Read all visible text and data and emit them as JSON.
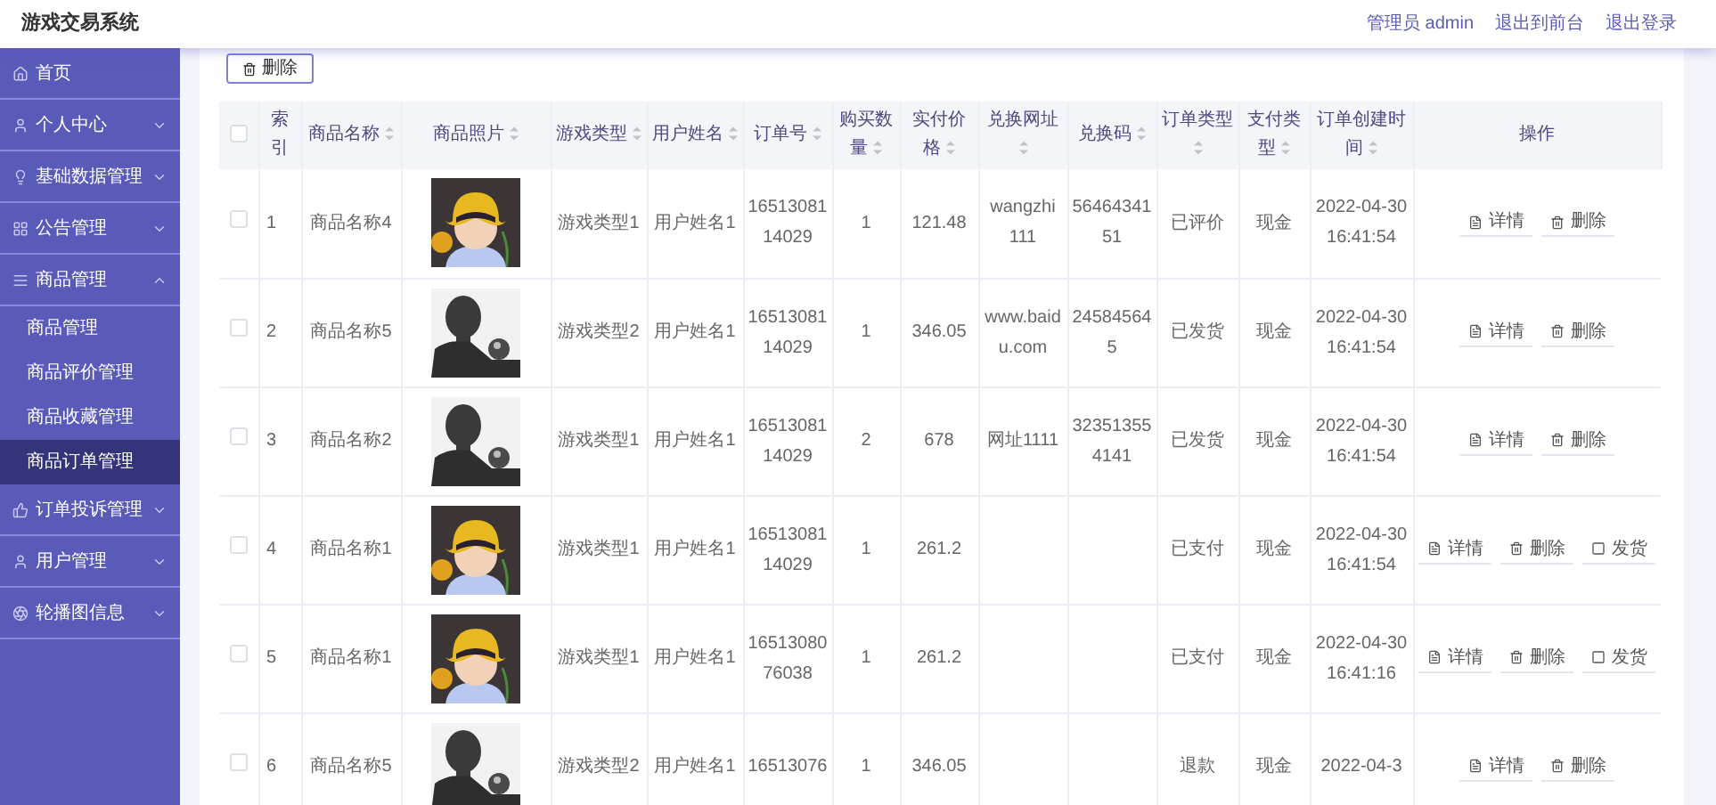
{
  "header": {
    "title": "游戏交易系统",
    "links": [
      "管理员 admin",
      "退出到前台",
      "退出登录"
    ]
  },
  "sidebar": {
    "items": [
      {
        "label": "首页"
      },
      {
        "label": "个人中心",
        "expanded": false
      },
      {
        "label": "基础数据管理",
        "expanded": false
      },
      {
        "label": "公告管理",
        "expanded": false
      },
      {
        "label": "商品管理",
        "expanded": true,
        "children": [
          {
            "label": "商品管理",
            "selected": false
          },
          {
            "label": "商品评价管理",
            "selected": false
          },
          {
            "label": "商品收藏管理",
            "selected": false
          },
          {
            "label": "商品订单管理",
            "selected": true
          }
        ]
      },
      {
        "label": "订单投诉管理",
        "expanded": false
      },
      {
        "label": "用户管理",
        "expanded": false
      },
      {
        "label": "轮播图信息",
        "expanded": false
      }
    ]
  },
  "toolbar": {
    "delete_button": "删除"
  },
  "table": {
    "header_checkbox": {
      "checked": false
    },
    "columns": [
      {
        "label": "索引",
        "sortable": false
      },
      {
        "label": "商品名称",
        "sortable": true
      },
      {
        "label": "商品照片",
        "sortable": true
      },
      {
        "label": "游戏类型",
        "sortable": true
      },
      {
        "label": "用户姓名",
        "sortable": true
      },
      {
        "label": "订单号",
        "sortable": true
      },
      {
        "label": "购买数量",
        "sortable": true
      },
      {
        "label": "实付价格",
        "sortable": true
      },
      {
        "label": "兑换网址",
        "sortable": true
      },
      {
        "label": "兑换码",
        "sortable": true
      },
      {
        "label": "订单类型",
        "sortable": true
      },
      {
        "label": "支付类型",
        "sortable": true
      },
      {
        "label": "订单创建时间",
        "sortable": true
      },
      {
        "label": "操作",
        "sortable": false
      }
    ],
    "rows": [
      {
        "checked": false,
        "index": "1",
        "name": "商品名称4",
        "photo": {
          "kind": "picture"
        },
        "game_type": "游戏类型1",
        "user": "用户姓名1",
        "order_no": "1651308114029",
        "qty": "1",
        "price": "121.48",
        "url": "wangzhi 111",
        "code": "5646434151",
        "order_type": "已评价",
        "pay_type": "现金",
        "created": "2022-04-30 16:41:54",
        "actions": [
          {
            "kind": "detail",
            "label": "详情"
          },
          {
            "kind": "delete",
            "label": "删除"
          }
        ]
      },
      {
        "checked": false,
        "index": "2",
        "name": "商品名称5",
        "photo": {
          "kind": "picture"
        },
        "game_type": "游戏类型2",
        "user": "用户姓名1",
        "order_no": "1651308114029",
        "qty": "1",
        "price": "346.05",
        "url": "www.baidu.com",
        "code": "245845645",
        "order_type": "已发货",
        "pay_type": "现金",
        "created": "2022-04-30 16:41:54",
        "actions": [
          {
            "kind": "detail",
            "label": "详情"
          },
          {
            "kind": "delete",
            "label": "删除"
          }
        ]
      },
      {
        "checked": false,
        "index": "3",
        "name": "商品名称2",
        "photo": {
          "kind": "picture"
        },
        "game_type": "游戏类型1",
        "user": "用户姓名1",
        "order_no": "1651308114029",
        "qty": "2",
        "price": "678",
        "url": "网址1111",
        "code": "323513554141",
        "order_type": "已发货",
        "pay_type": "现金",
        "created": "2022-04-30 16:41:54",
        "actions": [
          {
            "kind": "detail",
            "label": "详情"
          },
          {
            "kind": "delete",
            "label": "删除"
          }
        ]
      },
      {
        "checked": false,
        "index": "4",
        "name": "商品名称1",
        "photo": {
          "kind": "picture"
        },
        "game_type": "游戏类型1",
        "user": "用户姓名1",
        "order_no": "1651308114029",
        "qty": "1",
        "price": "261.2",
        "order_type": "已支付",
        "pay_type": "现金",
        "created": "2022-04-30 16:41:54",
        "actions": [
          {
            "kind": "detail",
            "label": "详情"
          },
          {
            "kind": "delete",
            "label": "删除"
          },
          {
            "kind": "ship",
            "label": "发货"
          }
        ]
      },
      {
        "checked": false,
        "index": "5",
        "name": "商品名称1",
        "photo": {
          "kind": "picture"
        },
        "game_type": "游戏类型1",
        "user": "用户姓名1",
        "order_no": "1651308076038",
        "qty": "1",
        "price": "261.2",
        "order_type": "已支付",
        "pay_type": "现金",
        "created": "2022-04-30 16:41:16",
        "actions": [
          {
            "kind": "detail",
            "label": "详情"
          },
          {
            "kind": "delete",
            "label": "删除"
          },
          {
            "kind": "ship",
            "label": "发货"
          }
        ]
      },
      {
        "checked": false,
        "index": "6",
        "name": "商品名称5",
        "photo": {
          "kind": "picture"
        },
        "game_type": "游戏类型2",
        "user": "用户姓名1",
        "order_no": "16513076",
        "qty": "1",
        "price": "346.05",
        "order_type": "退款",
        "pay_type": "现金",
        "created": "2022-04-3",
        "actions": [
          {
            "kind": "detail",
            "label": "详情"
          },
          {
            "kind": "delete",
            "label": "删除"
          }
        ]
      }
    ]
  }
}
